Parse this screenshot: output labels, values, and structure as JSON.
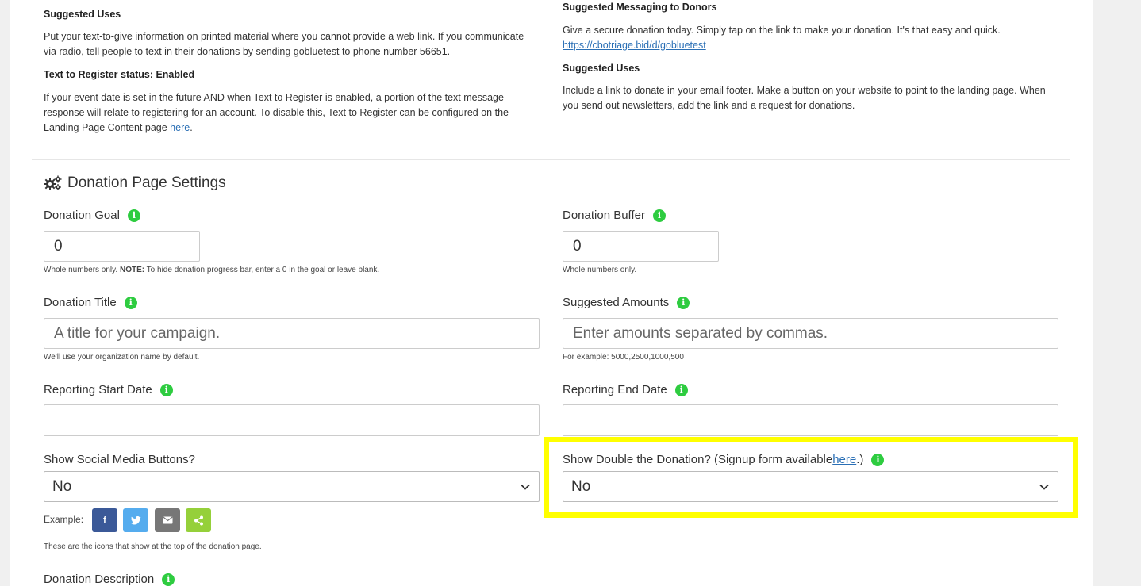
{
  "left_info": {
    "suggested_uses_heading": "Suggested Uses",
    "suggested_uses_line1": "Put your text-to-give information on printed material where you cannot provide a web link. If you communicate",
    "suggested_uses_line2": "via radio, tell people to text in their donations by sending gobluetest to phone number 56651.",
    "ttr_heading": "Text to Register status: Enabled",
    "ttr_line1": "If your event date is set in the future AND when Text to Register is enabled, a portion of the text message",
    "ttr_line2": "response will relate to registering for an account. To disable this, Text to Register can be configured on the",
    "ttr_line3_prefix": "Landing Page Content page ",
    "ttr_link": "here",
    "ttr_line3_suffix": "."
  },
  "right_info": {
    "messaging_heading": "Suggested Messaging to Donors",
    "messaging_text": "Give a secure donation today. Simply tap on the link to make your donation. It's that easy and quick.",
    "messaging_link": "https://cbotriage.bid/d/gobluetest",
    "suggested_uses_heading": "Suggested Uses",
    "suggested_uses_line1": "Include a link to donate in your email footer. Make a button on your website to point to the landing page. When",
    "suggested_uses_line2": "you send out newsletters, add the link and a request for donations."
  },
  "settings": {
    "title": "Donation Page Settings",
    "donation_goal": {
      "label": "Donation Goal",
      "value": "0",
      "help_prefix": "Whole numbers only. ",
      "help_bold": "NOTE:",
      "help_suffix": " To hide donation progress bar, enter a 0 in the goal or leave blank."
    },
    "donation_buffer": {
      "label": "Donation Buffer",
      "value": "0",
      "help": "Whole numbers only."
    },
    "donation_title": {
      "label": "Donation Title",
      "placeholder": "A title for your campaign.",
      "help": "We'll use your organization name by default."
    },
    "suggested_amounts": {
      "label": "Suggested Amounts",
      "placeholder": "Enter amounts separated by commas.",
      "help": "For example: 5000,2500,1000,500"
    },
    "reporting_start": {
      "label": "Reporting Start Date",
      "value": ""
    },
    "reporting_end": {
      "label": "Reporting End Date",
      "value": ""
    },
    "social_buttons": {
      "label": "Show Social Media Buttons?",
      "value": "No",
      "example_label": "Example:",
      "help": "These are the icons that show at the top of the donation page."
    },
    "double_donation": {
      "label_prefix": "Show Double the Donation? (Signup form available ",
      "label_link": "here",
      "label_suffix": ".)",
      "value": "No"
    },
    "donation_description": {
      "label": "Donation Description"
    }
  },
  "icons": {
    "info": "info-icon",
    "gears": "gears-icon",
    "facebook": "facebook-icon",
    "twitter": "twitter-icon",
    "email": "email-icon",
    "share": "share-icon"
  },
  "colors": {
    "info_green": "#2ecc40",
    "facebook": "#3b5998",
    "twitter": "#55acee",
    "email": "#777777",
    "share": "#95d03a",
    "highlight": "#ffff00",
    "link": "#2a6fb5"
  }
}
